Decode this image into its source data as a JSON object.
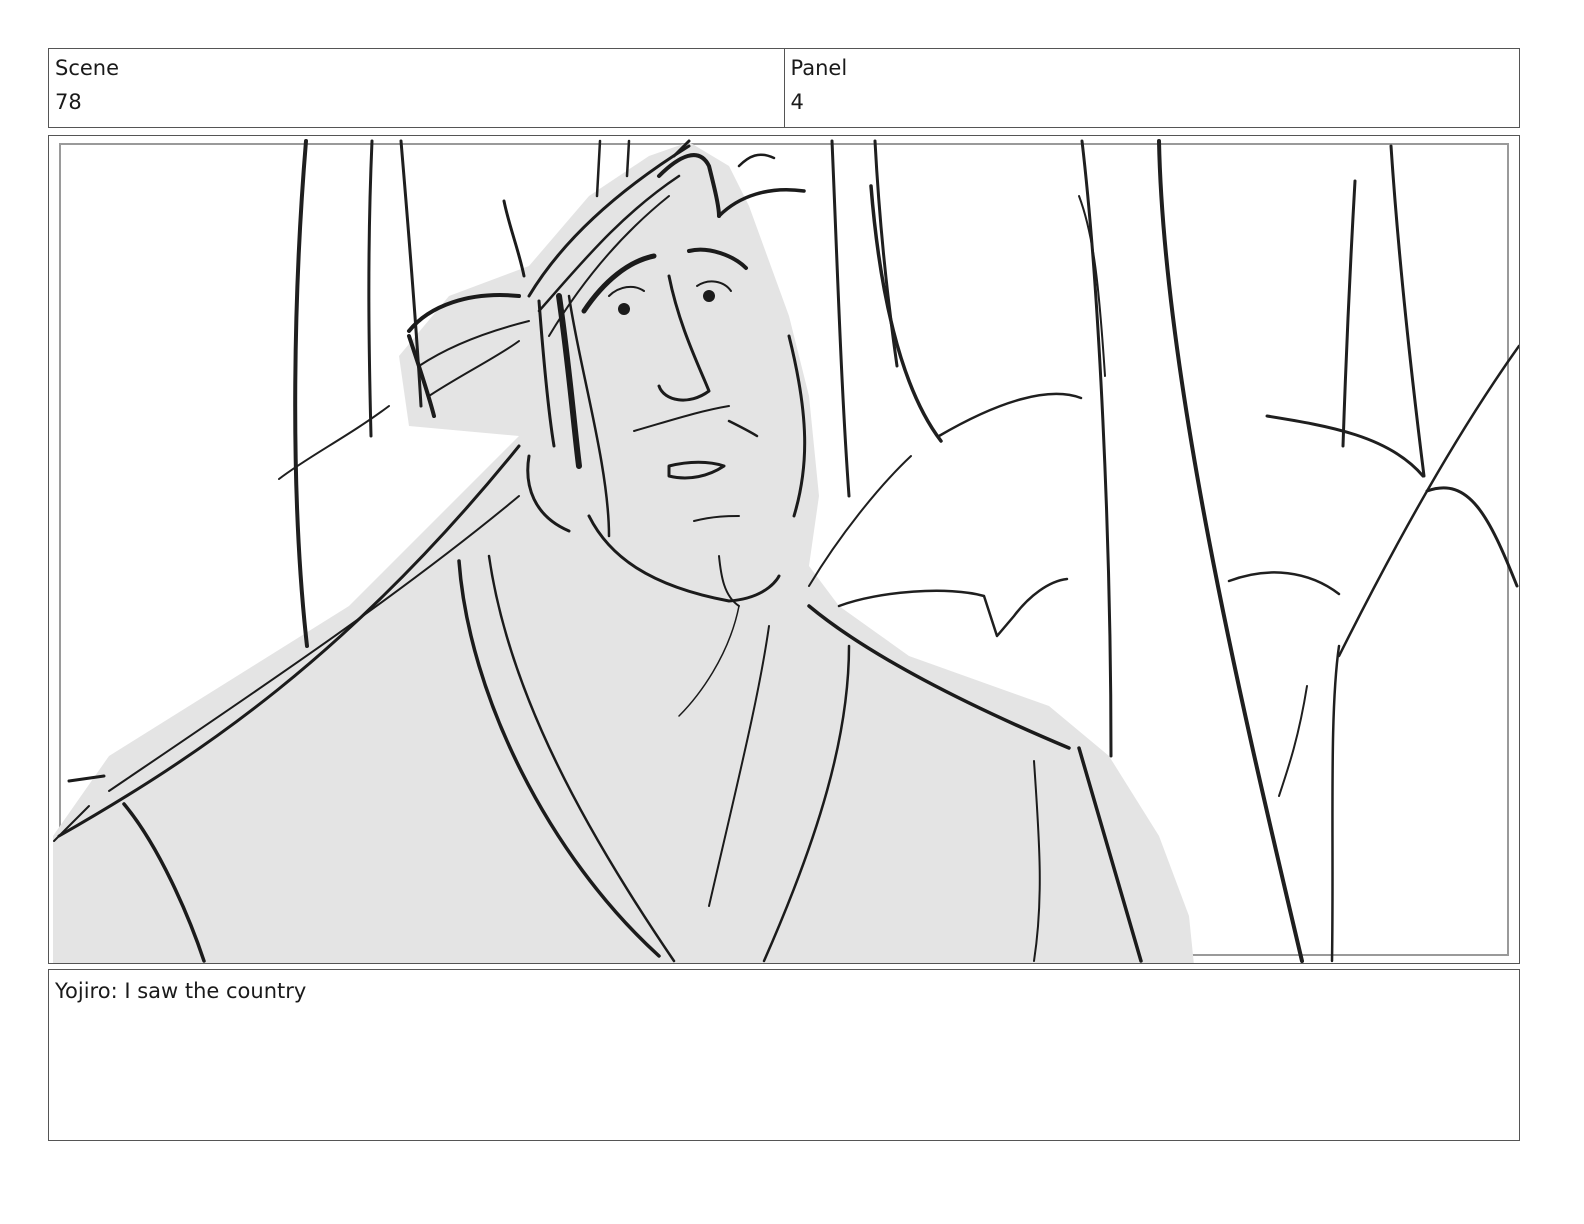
{
  "header": {
    "scene_label": "Scene",
    "scene_value": "78",
    "panel_label": "Panel",
    "panel_value": "4"
  },
  "panel": {
    "image_subject": "storyboard sketch of a man with topknot looking up, trees in background"
  },
  "caption": {
    "dialogue": "Yojiro: I saw the country"
  }
}
